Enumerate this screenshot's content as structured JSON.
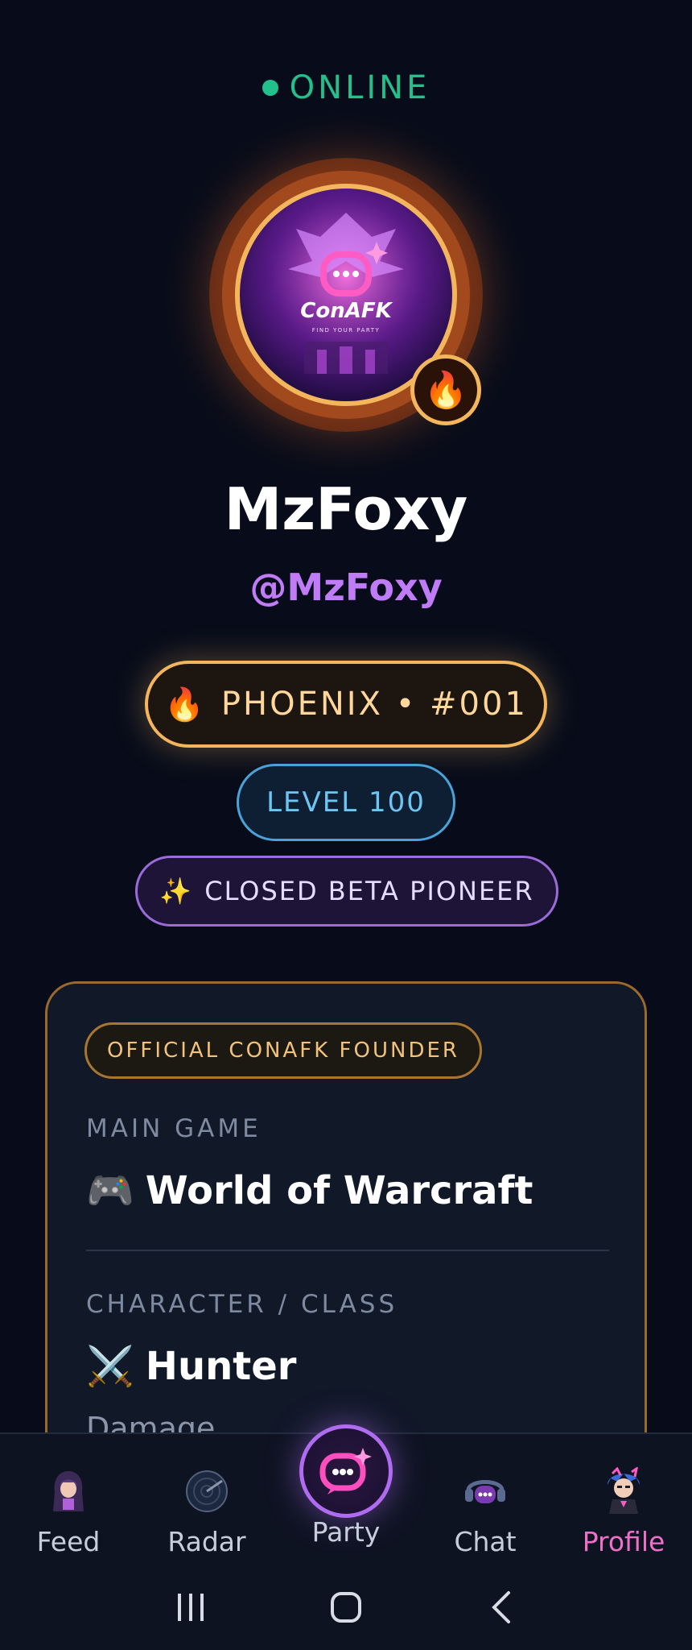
{
  "status": {
    "label": "ONLINE",
    "color": "#22c08a"
  },
  "profile": {
    "display_name": "MzFoxy",
    "handle": "@MzFoxy",
    "avatar_logo_text": "ConAFK",
    "avatar_tagline": "FIND YOUR PARTY",
    "badge_icon": "fire-icon"
  },
  "badges": {
    "phoenix": "PHOENIX • #001",
    "level": "LEVEL 100",
    "beta": "CLOSED BETA PIONEER"
  },
  "card": {
    "founder_label": "OFFICIAL CONAFK FOUNDER",
    "main_game_label": "MAIN GAME",
    "main_game_value": "World of Warcraft",
    "character_label": "CHARACTER / CLASS",
    "character_value": "Hunter",
    "role_value": "Damage"
  },
  "nav": {
    "items": [
      {
        "label": "Feed",
        "icon": "hooded-avatar-icon"
      },
      {
        "label": "Radar",
        "icon": "radar-icon"
      },
      {
        "label": "Party",
        "icon": "party-logo-icon"
      },
      {
        "label": "Chat",
        "icon": "chat-headset-icon"
      },
      {
        "label": "Profile",
        "icon": "profile-avatar-icon"
      }
    ],
    "active": "Profile"
  },
  "colors": {
    "accent_gold": "#f4b65c",
    "accent_purple": "#c07cf6",
    "accent_pink": "#f070c9",
    "background": "#080c1a"
  }
}
